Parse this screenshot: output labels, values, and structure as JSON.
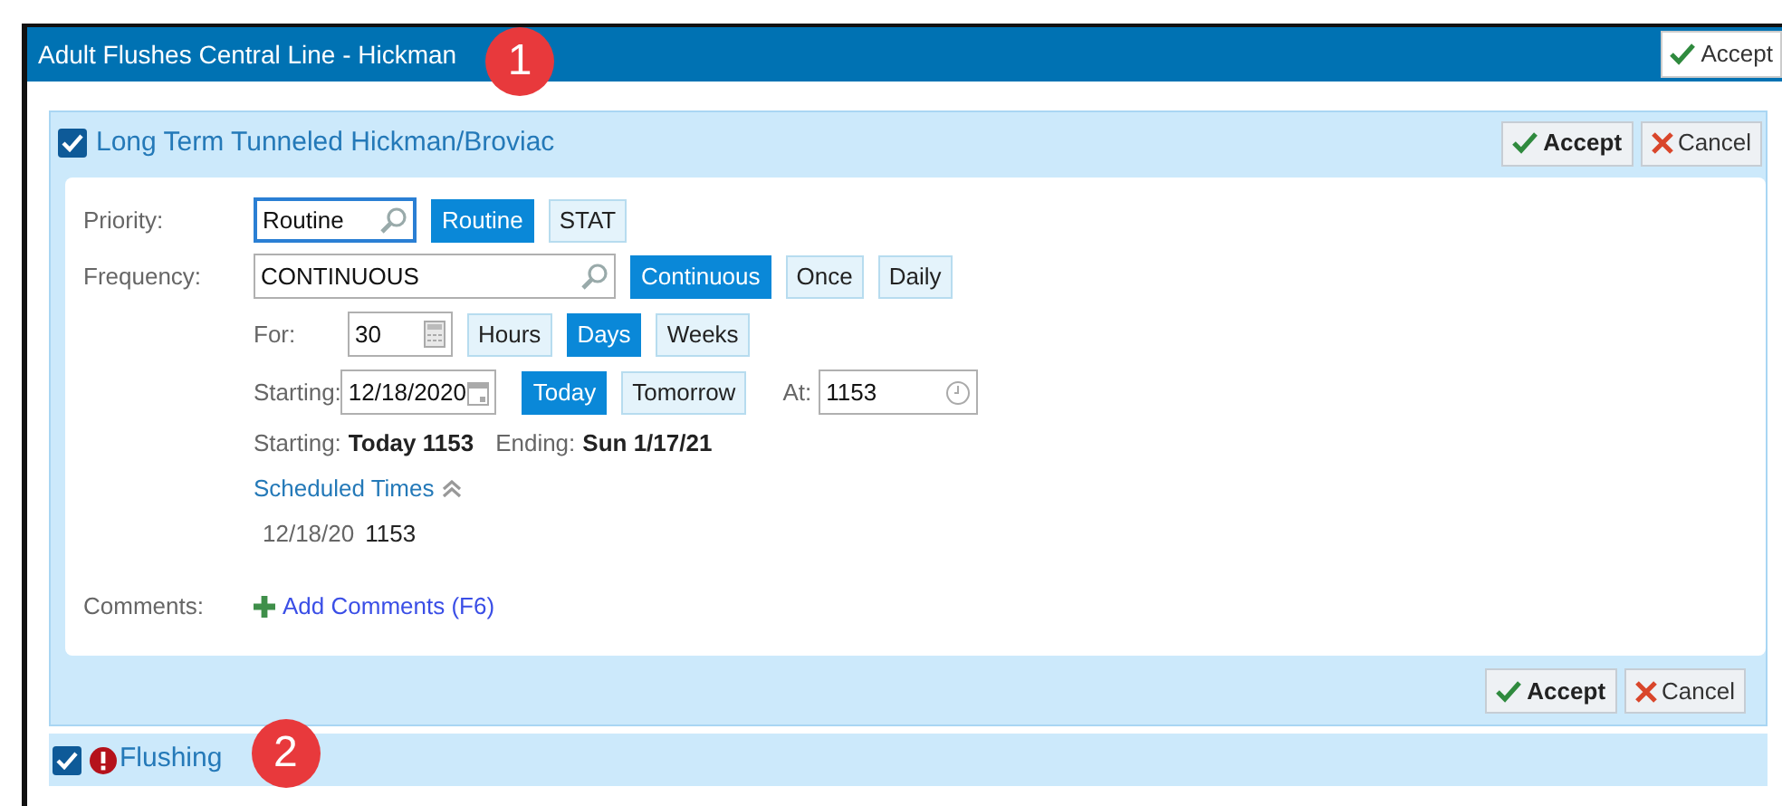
{
  "window": {
    "title": "Adult Flushes Central Line - Hickman",
    "marker": "1",
    "button": {
      "label": "Accept",
      "kind": "accept"
    }
  },
  "section": {
    "title": "Long Term Tunneled Hickman/Broviac",
    "checked": true,
    "buttons": [
      {
        "label": "Accept",
        "kind": "accept"
      },
      {
        "label": "Cancel",
        "kind": "cancel"
      }
    ],
    "priority": {
      "label": "Priority:",
      "value": "Routine",
      "options": [
        {
          "label": "Routine",
          "selected": true
        },
        {
          "label": "STAT",
          "selected": false
        }
      ]
    },
    "frequency": {
      "label": "Frequency:",
      "value": "CONTINUOUS",
      "options": [
        {
          "label": "Continuous",
          "selected": true
        },
        {
          "label": "Once",
          "selected": false
        },
        {
          "label": "Daily",
          "selected": false
        }
      ]
    },
    "duration": {
      "label": "For:",
      "value": "30",
      "options": [
        {
          "label": "Hours",
          "selected": false
        },
        {
          "label": "Days",
          "selected": true
        },
        {
          "label": "Weeks",
          "selected": false
        }
      ]
    },
    "start": {
      "label": "Starting:",
      "value": "12/18/2020",
      "options": [
        {
          "label": "Today",
          "selected": true
        },
        {
          "label": "Tomorrow",
          "selected": false
        }
      ],
      "at_label": "At:",
      "at_value": "1153"
    },
    "summary": {
      "start_label": "Starting:",
      "start_value": "Today 1153",
      "end_label": "Ending:",
      "end_value": "Sun 1/17/21"
    },
    "scheduled": {
      "label": "Scheduled Times",
      "expanded": true,
      "times": [
        {
          "date": "12/18/20",
          "time": "1153"
        }
      ]
    },
    "comments": {
      "label": "Comments:",
      "link": "Add Comments (F6)"
    },
    "footer_buttons": [
      {
        "label": "Accept",
        "kind": "accept"
      },
      {
        "label": "Cancel",
        "kind": "cancel"
      }
    ]
  },
  "next_section": {
    "title": "Flushing",
    "checked": true,
    "alert": true,
    "marker": "2"
  }
}
